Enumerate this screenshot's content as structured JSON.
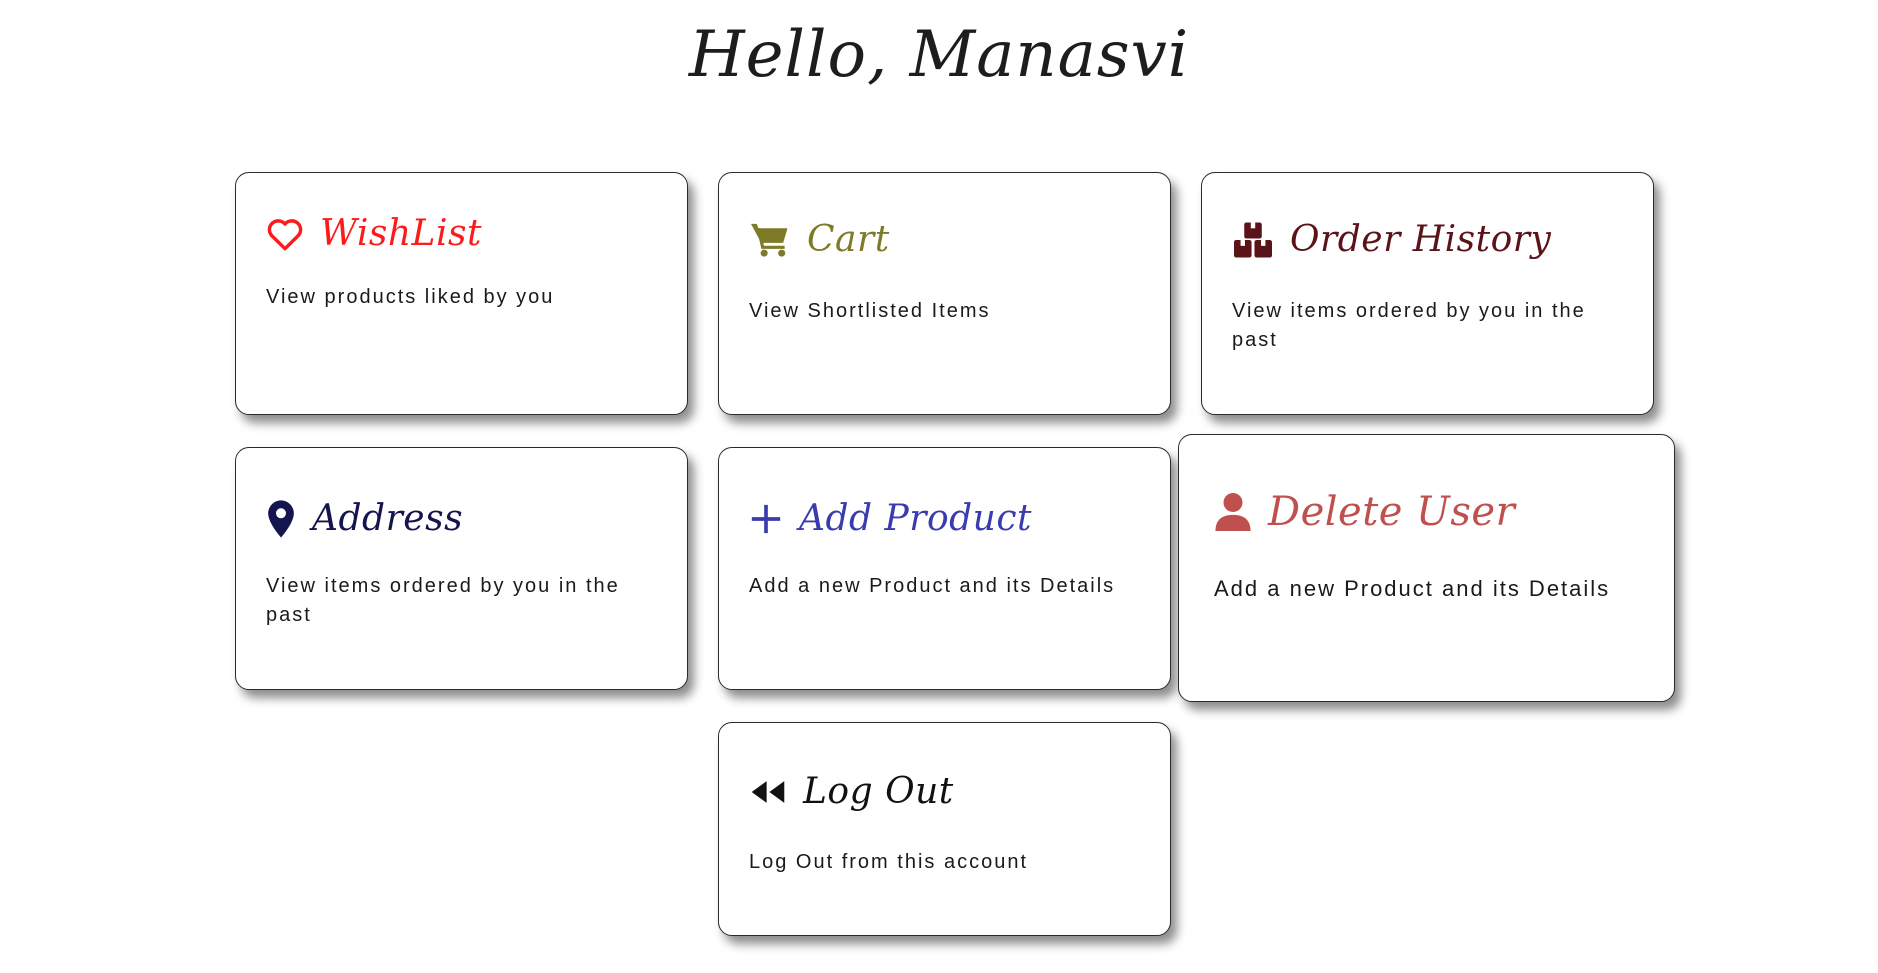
{
  "greeting": "Hello, Manasvi",
  "cards": [
    {
      "title": "WishList",
      "description": "View products liked by you",
      "icon": "heart-icon",
      "color": "#ff1a1a"
    },
    {
      "title": "Cart",
      "description": "View Shortlisted Items",
      "icon": "cart-icon",
      "color": "#7d7a28"
    },
    {
      "title": "Order History",
      "description": "View items ordered by you in the past",
      "icon": "boxes-icon",
      "color": "#5a1419"
    },
    {
      "title": "Address",
      "description": "View items ordered by you in the past",
      "icon": "location-pin-icon",
      "color": "#14144f"
    },
    {
      "title": "Add Product",
      "description": "Add a new Product and its Details",
      "icon": "plus-icon",
      "color": "#3b3bb0"
    },
    {
      "title": "Delete User",
      "description": "Add a new Product and its Details",
      "icon": "user-icon",
      "color": "#c0504d"
    },
    {
      "title": "Log Out",
      "description": "Log Out from this account",
      "icon": "rewind-icon",
      "color": "#111111"
    }
  ]
}
